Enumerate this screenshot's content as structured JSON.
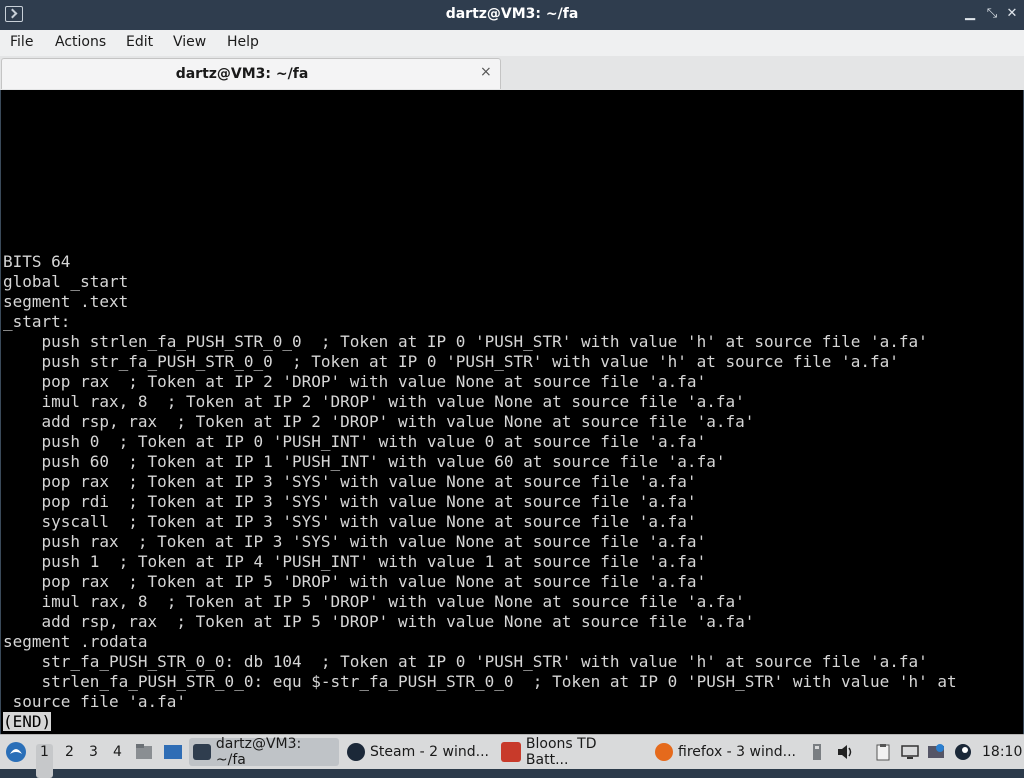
{
  "window": {
    "title": "dartz@VM3: ~/fa",
    "controls": [
      "minimize",
      "maximize",
      "close"
    ]
  },
  "menubar": {
    "items": [
      "File",
      "Actions",
      "Edit",
      "View",
      "Help"
    ]
  },
  "tabs": [
    {
      "label": "dartz@VM3: ~/fa",
      "close": "×"
    }
  ],
  "terminal": {
    "lines": [
      "BITS 64",
      "global _start",
      "segment .text",
      "_start:",
      "    push strlen_fa_PUSH_STR_0_0  ; Token at IP 0 'PUSH_STR' with value 'h' at source file 'a.fa'",
      "    push str_fa_PUSH_STR_0_0  ; Token at IP 0 'PUSH_STR' with value 'h' at source file 'a.fa'",
      "    pop rax  ; Token at IP 2 'DROP' with value None at source file 'a.fa'",
      "    imul rax, 8  ; Token at IP 2 'DROP' with value None at source file 'a.fa'",
      "    add rsp, rax  ; Token at IP 2 'DROP' with value None at source file 'a.fa'",
      "    push 0  ; Token at IP 0 'PUSH_INT' with value 0 at source file 'a.fa'",
      "    push 60  ; Token at IP 1 'PUSH_INT' with value 60 at source file 'a.fa'",
      "    pop rax  ; Token at IP 3 'SYS' with value None at source file 'a.fa'",
      "    pop rdi  ; Token at IP 3 'SYS' with value None at source file 'a.fa'",
      "    syscall  ; Token at IP 3 'SYS' with value None at source file 'a.fa'",
      "    push rax  ; Token at IP 3 'SYS' with value None at source file 'a.fa'",
      "    push 1  ; Token at IP 4 'PUSH_INT' with value 1 at source file 'a.fa'",
      "    pop rax  ; Token at IP 5 'DROP' with value None at source file 'a.fa'",
      "    imul rax, 8  ; Token at IP 5 'DROP' with value None at source file 'a.fa'",
      "    add rsp, rax  ; Token at IP 5 'DROP' with value None at source file 'a.fa'",
      "segment .rodata",
      "    str_fa_PUSH_STR_0_0: db 104  ; Token at IP 0 'PUSH_STR' with value 'h' at source file 'a.fa'",
      "    strlen_fa_PUSH_STR_0_0: equ $-str_fa_PUSH_STR_0_0  ; Token at IP 0 'PUSH_STR' with value 'h' at",
      " source file 'a.fa'"
    ],
    "end_marker": "(END)"
  },
  "taskbar": {
    "start_icon": "start-menu-icon",
    "desktops": [
      "1",
      "2",
      "3",
      "4"
    ],
    "active_desktop": "1",
    "tasks": [
      {
        "label": "dartz@VM3: ~/fa",
        "icon": "terminal-icon",
        "active": true
      },
      {
        "label": "Steam - 2 wind...",
        "icon": "steam-icon",
        "active": false
      },
      {
        "label": "Bloons TD Batt...",
        "icon": "bloons-icon",
        "active": false
      },
      {
        "label": "firefox - 3 wind...",
        "icon": "firefox-icon",
        "active": false
      }
    ],
    "tray_icons": [
      "usb-drive-icon",
      "volume-icon",
      "clipboard-icon",
      "network-icon",
      "update-icon",
      "steam-tray-icon"
    ],
    "clock": "18:10"
  },
  "colors": {
    "titlebar_bg": "#2f3d4e",
    "terminal_bg": "#000000",
    "terminal_fg": "#d6d6d6",
    "taskbar_bg": "#d9dadb"
  }
}
